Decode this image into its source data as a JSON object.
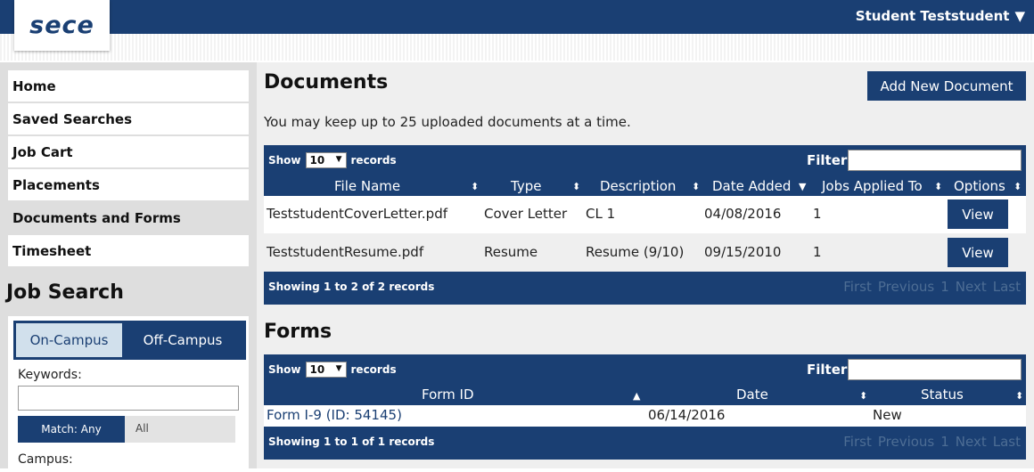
{
  "header": {
    "logo_text": "sece",
    "user_name": "Student Teststudent",
    "user_menu_caret": "▼"
  },
  "sidebar": {
    "nav": [
      {
        "label": "Home"
      },
      {
        "label": "Saved Searches"
      },
      {
        "label": "Job Cart"
      },
      {
        "label": "Placements"
      },
      {
        "label": "Documents and Forms",
        "active": true
      },
      {
        "label": "Timesheet"
      }
    ],
    "job_search": {
      "title": "Job Search",
      "tab_on_campus": "On-Campus",
      "tab_off_campus": "Off-Campus",
      "keywords_label": "Keywords:",
      "keywords_value": "",
      "match_any": "Match: Any",
      "match_all": "All",
      "campus_label": "Campus:"
    }
  },
  "documents": {
    "title": "Documents",
    "add_button": "Add New Document",
    "note": "You may keep up to 25 uploaded documents at a time.",
    "show_label": "Show",
    "show_value": "10",
    "records_label": "records",
    "filter_label": "Filter:",
    "filter_value": "",
    "columns": [
      "File Name",
      "Type",
      "Description",
      "Date Added",
      "Jobs Applied To",
      "Options"
    ],
    "rows": [
      {
        "file": "TeststudentCoverLetter.pdf",
        "type": "Cover Letter",
        "desc": "CL 1",
        "date": "04/08/2016",
        "jobs": "1",
        "action": "View"
      },
      {
        "file": "TeststudentResume.pdf",
        "type": "Resume",
        "desc": "Resume (9/10)",
        "date": "09/15/2010",
        "jobs": "1",
        "action": "View"
      }
    ],
    "footer": "Showing 1 to 2 of 2 records",
    "pager": {
      "first": "First",
      "previous": "Previous",
      "page": "1",
      "next": "Next",
      "last": "Last"
    }
  },
  "forms": {
    "title": "Forms",
    "show_label": "Show",
    "show_value": "10",
    "records_label": "records",
    "filter_label": "Filter:",
    "filter_value": "",
    "columns": [
      "Form ID",
      "Date",
      "Status"
    ],
    "rows": [
      {
        "form": "Form I-9 (ID: 54145)",
        "date": "06/14/2016",
        "status": "New"
      }
    ],
    "footer": "Showing 1 to 1 of 1 records",
    "pager": {
      "first": "First",
      "previous": "Previous",
      "page": "1",
      "next": "Next",
      "last": "Last"
    }
  },
  "colors": {
    "brand": "#1a3f73",
    "sidebar_bg": "#dedede",
    "tab_active_bg": "#d1e0ec",
    "pager_text": "#4d6d94"
  },
  "icons": {
    "sort_both": "sort-both-icon",
    "sort_asc": "sort-asc-icon",
    "sort_desc": "sort-desc-icon",
    "caret": "caret-down-icon"
  }
}
